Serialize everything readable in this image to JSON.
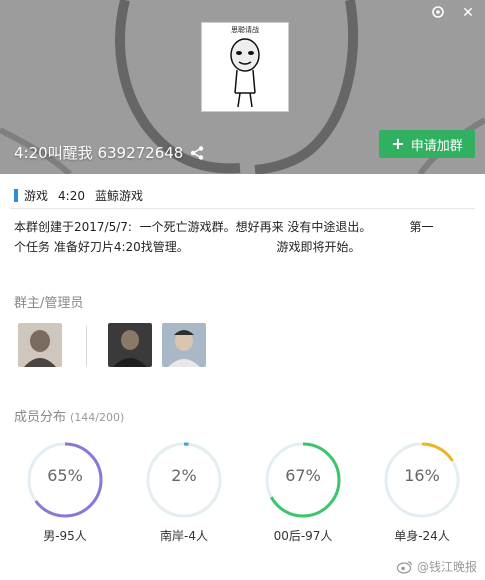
{
  "window": {
    "pin_icon": "pin-icon",
    "close_icon": "close-icon",
    "close_label": "✕"
  },
  "header": {
    "avatar_caption": "思聪请战",
    "group_name": "4:20叫醒我 639272648",
    "share_icon": "share-icon",
    "join_button": "申请加群",
    "join_icon": "plus-icon"
  },
  "tags": [
    "游戏",
    "4:20",
    "蓝鲸游戏"
  ],
  "description": {
    "line1": "本群创建于2017/5/7:  一个死亡游戏群。想好再来 没有中途退出。          第一",
    "line2": "个任务 准备好刀片4:20找管理。                       游戏即将开始。"
  },
  "admins": {
    "title": "群主/管理员",
    "owner": {
      "avatar_icon": "owner-avatar"
    },
    "managers": [
      {
        "avatar_icon": "admin-avatar-1"
      },
      {
        "avatar_icon": "admin-avatar-2"
      }
    ]
  },
  "members": {
    "title": "成员分布",
    "count": "(144/200)",
    "stats": [
      {
        "pct_text": "65%",
        "value": 0.65,
        "label": "男-95人",
        "color": "#8a78d8"
      },
      {
        "pct_text": "2%",
        "value": 0.02,
        "label": "南岸-4人",
        "color": "#3fa0e0"
      },
      {
        "pct_text": "67%",
        "value": 0.67,
        "label": "00后-97人",
        "color": "#3cc66a"
      },
      {
        "pct_text": "16%",
        "value": 0.16,
        "label": "单身-24人",
        "color": "#e8b820"
      }
    ]
  },
  "watermark": {
    "text": "@钱江晚报",
    "icon": "weibo-icon"
  }
}
